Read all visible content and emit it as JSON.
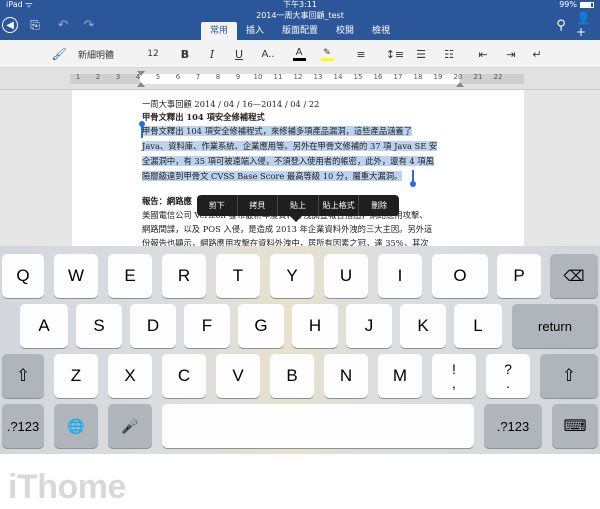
{
  "status": {
    "left": "iPad ᯤ",
    "time": "下午3:11",
    "battery": "99%"
  },
  "document_title": "2014一周大事回顧_test",
  "toolbar": {
    "back": "◀",
    "file": "⎘",
    "undo": "↶",
    "redo": "↷",
    "search": "⚲",
    "share": "👤+"
  },
  "tabs": [
    {
      "label": "常用",
      "active": true
    },
    {
      "label": "插入",
      "active": false
    },
    {
      "label": "版面配置",
      "active": false
    },
    {
      "label": "校閱",
      "active": false
    },
    {
      "label": "檢視",
      "active": false
    }
  ],
  "ribbon": {
    "format_painter": "🖌",
    "font_name": "新細明體",
    "font_size": "12",
    "bold": "B",
    "italic": "I",
    "underline": "U",
    "font_effects": "A..",
    "font_color": "A",
    "highlight": "✎",
    "align": "≡",
    "spacing": "↕≡",
    "bullets": "☰",
    "numbering": "☷",
    "outdent": "⇤",
    "indent": "⇥",
    "paragraph": "↵"
  },
  "ruler": {
    "numbers": [
      "1",
      "2",
      "3",
      "4",
      "5",
      "6",
      "7",
      "8",
      "9",
      "10",
      "11",
      "12",
      "13",
      "14",
      "15",
      "16",
      "17",
      "18",
      "19",
      "20",
      "21",
      "22"
    ]
  },
  "doc": {
    "line0": "一周大事回顧 2014 / 04 / 16—2014 / 04 / 22",
    "heading1": "甲骨文釋出 104 項安全修補程式",
    "line2": "甲骨文釋出 104 項安全修補程式，來修補多項產品漏洞，這些產品涵蓋了",
    "line3": "Java、資料庫、作業系統、企業應用等。另外在甲骨文修補的 37 項 Java SE 安",
    "line4": "全漏洞中，有 35 項可被遠端入侵，不須登入使用者的帳密，此外，還有 4 項風",
    "line5": "險層級達到甲骨文 CVSS Base Score 最高等級 10 分，屬重大漏洞。",
    "heading2": "報告：網路應",
    "line7": "美國電信公司 Verizon 發布最新年度資料外洩調查報告指出，網路應用攻擊、",
    "line8": "網路間諜，以及 POS 入侵，是造成 2013 年企業資料外洩的三大主因。另外這",
    "line9": "份報告也顯示，網路應用攻擊在資料外洩中，居所有因素之冠，達 35%，其次"
  },
  "context_menu": [
    "剪下",
    "拷貝",
    "貼上",
    "貼上格式",
    "刪除"
  ],
  "keyboard": {
    "row1": [
      "Q",
      "W",
      "E",
      "R",
      "T",
      "Y",
      "U",
      "I",
      "O",
      "P"
    ],
    "backspace": "⌫",
    "row2": [
      "A",
      "S",
      "D",
      "F",
      "G",
      "H",
      "J",
      "K",
      "L"
    ],
    "return": "return",
    "shift": "⇧",
    "row3": [
      "Z",
      "X",
      "C",
      "V",
      "B",
      "N",
      "M"
    ],
    "punct1_top": "!",
    "punct1_bottom": ",",
    "punct2_top": "?",
    "punct2_bottom": ".",
    "numbers": ".?123",
    "globe": "🌐",
    "mic": "🎤",
    "hide": "⌨"
  },
  "logo": "iThome"
}
